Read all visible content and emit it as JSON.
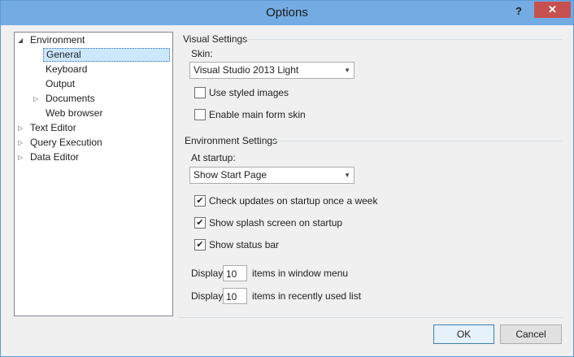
{
  "window": {
    "title": "Options",
    "help_label": "?",
    "close_label": "✕"
  },
  "tree": {
    "items": [
      {
        "label": "Environment",
        "expanded": true
      },
      {
        "label": "General",
        "selected": true
      },
      {
        "label": "Keyboard"
      },
      {
        "label": "Output"
      },
      {
        "label": "Documents",
        "expandable": true
      },
      {
        "label": "Web browser"
      },
      {
        "label": "Text Editor",
        "expandable": true
      },
      {
        "label": "Query Execution",
        "expandable": true
      },
      {
        "label": "Data Editor",
        "expandable": true
      }
    ],
    "arrow_expanded": "◢",
    "arrow_collapsed": "▷"
  },
  "visual": {
    "title": "Visual Settings",
    "skin_label": "Skin:",
    "skin_value": "Visual Studio 2013 Light",
    "use_styled_images": {
      "label": "Use styled images",
      "checked": false
    },
    "enable_main_form_skin": {
      "label": "Enable main form skin",
      "checked": false
    }
  },
  "env": {
    "title": "Environment Settings",
    "startup_label": "At startup:",
    "startup_value": "Show Start Page",
    "check_updates": {
      "label": "Check updates on startup once a week",
      "checked": true
    },
    "splash": {
      "label": "Show splash screen on startup",
      "checked": true
    },
    "status_bar": {
      "label": "Show status bar",
      "checked": true
    },
    "window_menu": {
      "prefix": "Display",
      "value": "10",
      "suffix": "items in window menu"
    },
    "recent_list": {
      "prefix": "Display",
      "value": "10",
      "suffix": "items in recently used list"
    }
  },
  "glyphs": {
    "check": "✔",
    "dropdown": "▼"
  },
  "buttons": {
    "ok": "OK",
    "cancel": "Cancel"
  }
}
